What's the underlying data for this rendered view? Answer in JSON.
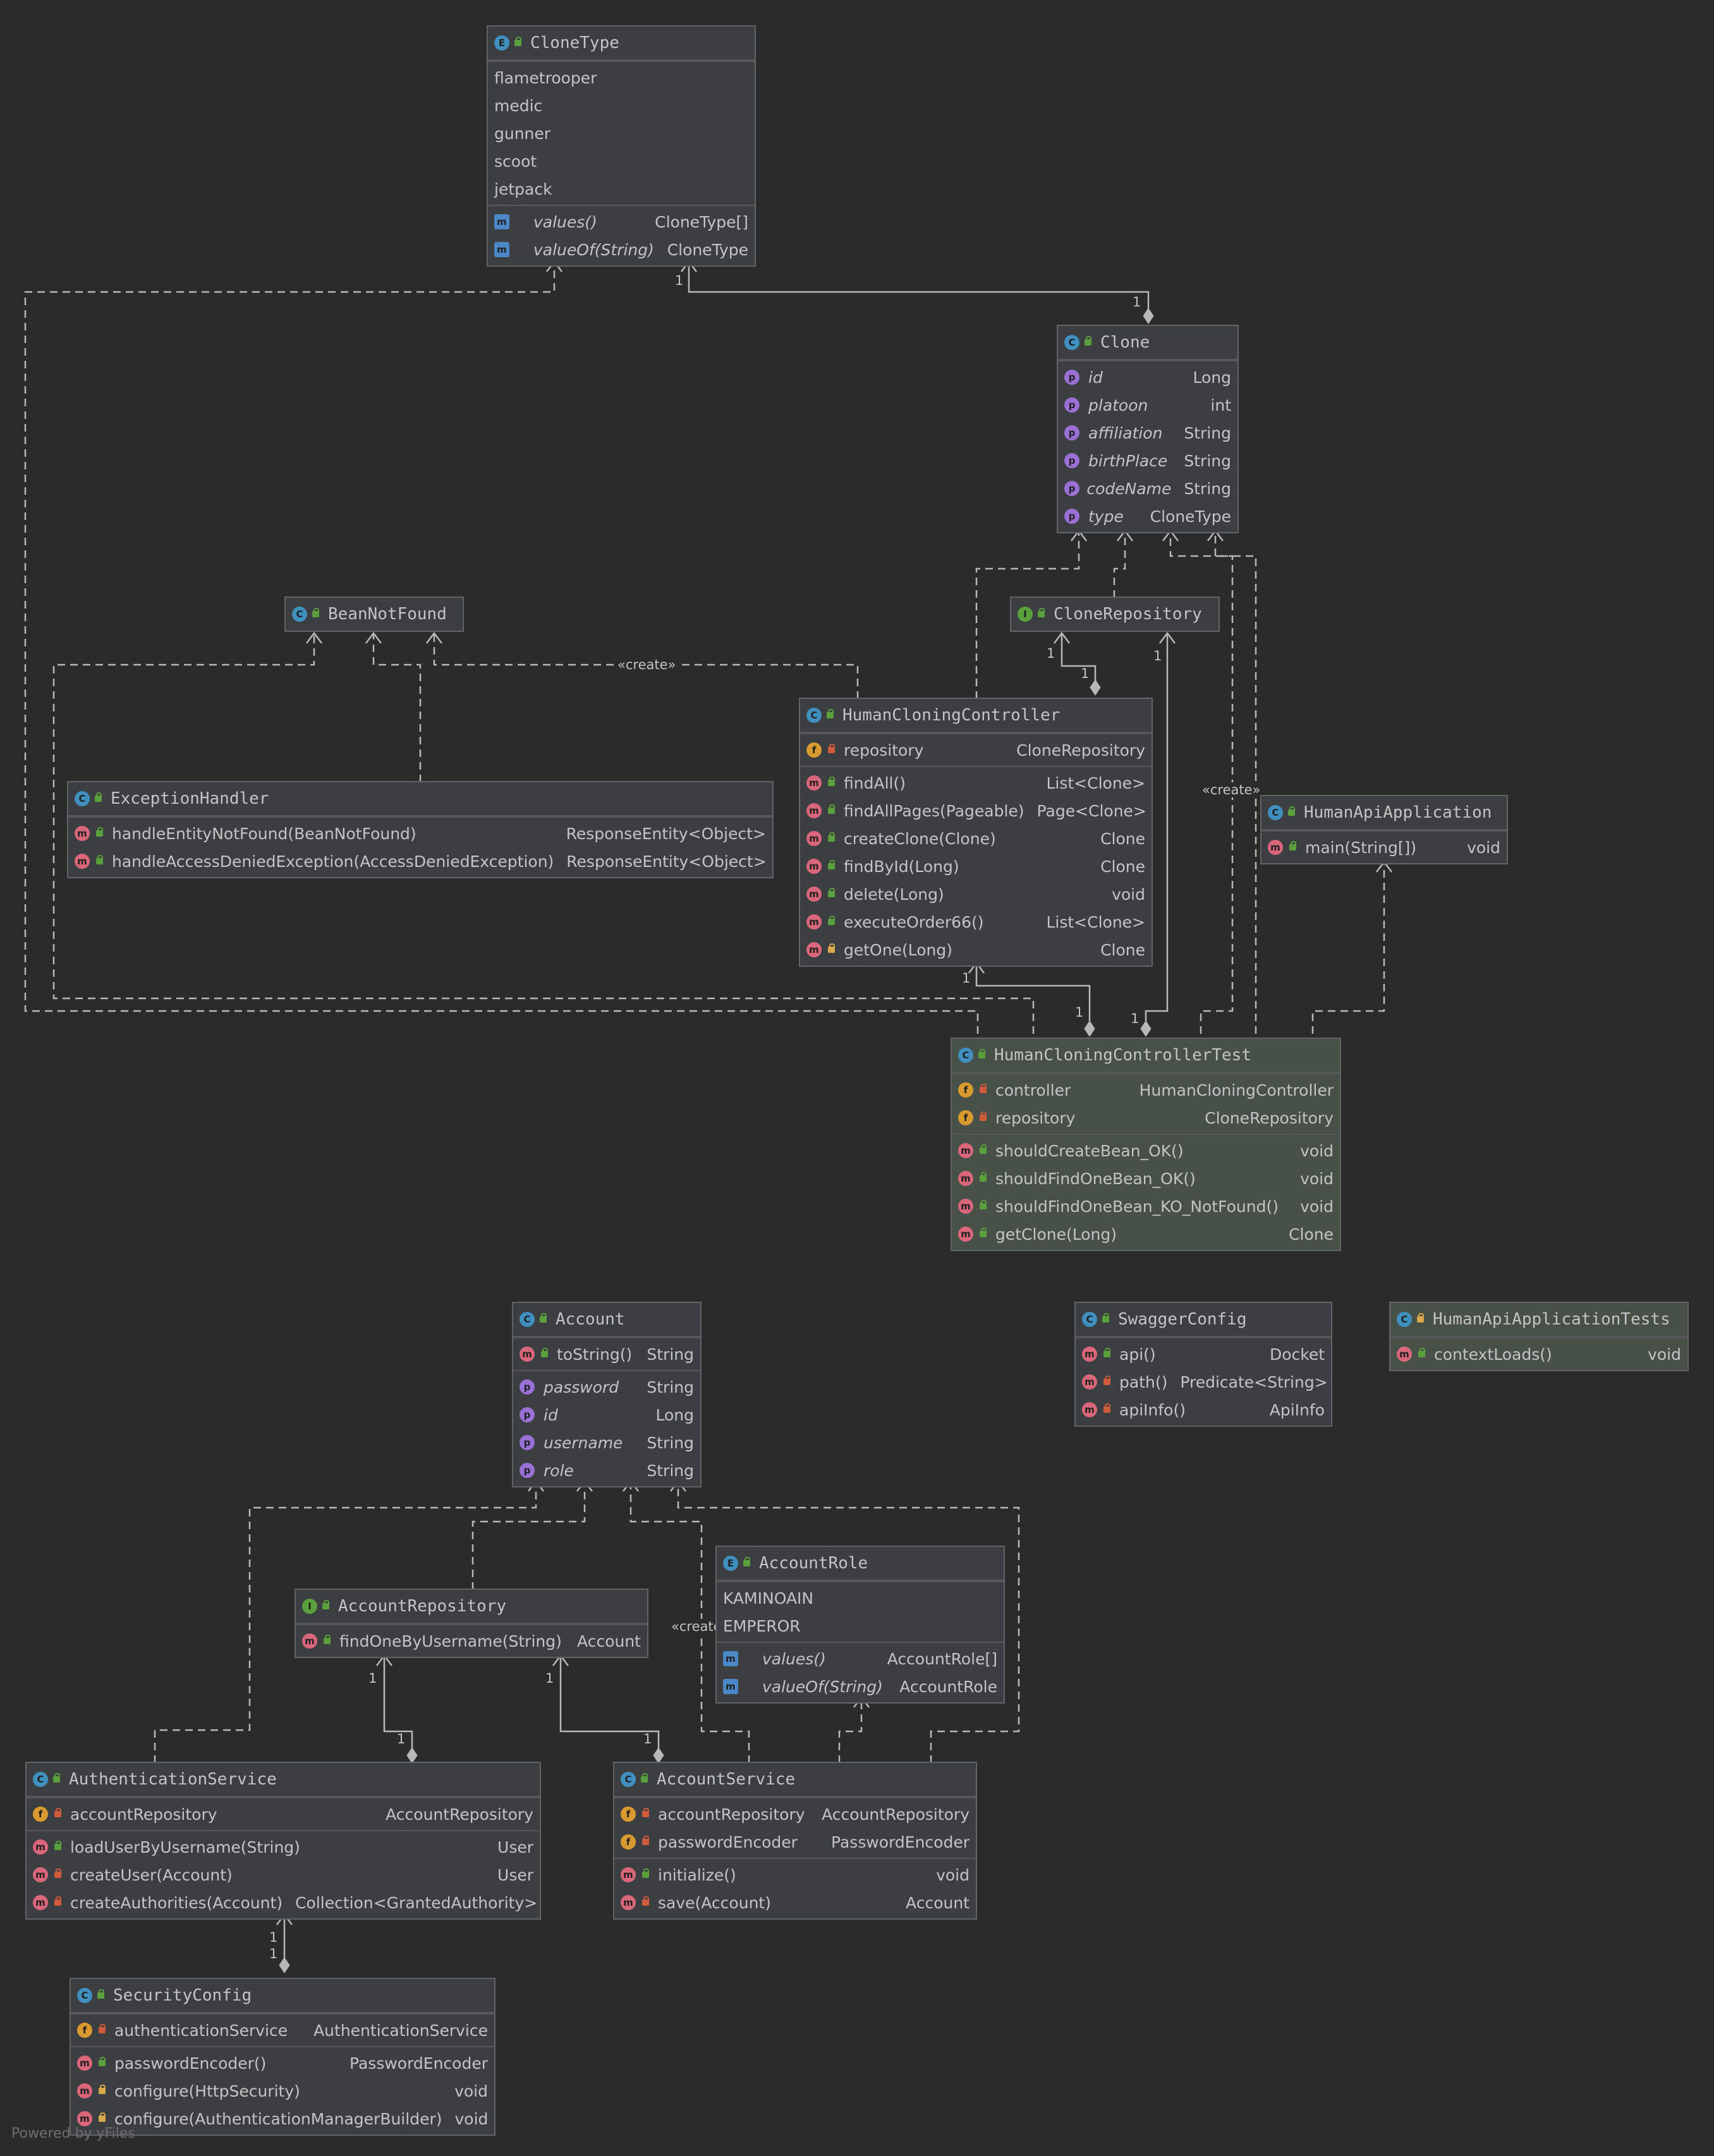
{
  "classes": {
    "CloneType": {
      "name": "CloneType",
      "kind": "enum",
      "constants": [
        "flametrooper",
        "medic",
        "gunner",
        "scoot",
        "jetpack"
      ],
      "methods": [
        {
          "name": "values()",
          "type": "CloneType[]"
        },
        {
          "name": "valueOf(String)",
          "type": "CloneType"
        }
      ]
    },
    "Clone": {
      "name": "Clone",
      "kind": "class",
      "properties": [
        {
          "name": "id",
          "type": "Long"
        },
        {
          "name": "platoon",
          "type": "int"
        },
        {
          "name": "affiliation",
          "type": "String"
        },
        {
          "name": "birthPlace",
          "type": "String"
        },
        {
          "name": "codeName",
          "type": "String"
        },
        {
          "name": "type",
          "type": "CloneType"
        }
      ]
    },
    "BeanNotFound": {
      "name": "BeanNotFound",
      "kind": "class"
    },
    "CloneRepository": {
      "name": "CloneRepository",
      "kind": "interface"
    },
    "HumanCloningController": {
      "name": "HumanCloningController",
      "kind": "class",
      "fields": [
        {
          "name": "repository",
          "type": "CloneRepository"
        }
      ],
      "methods": [
        {
          "name": "findAll()",
          "type": "List<Clone>"
        },
        {
          "name": "findAllPages(Pageable)",
          "type": "Page<Clone>"
        },
        {
          "name": "createClone(Clone)",
          "type": "Clone"
        },
        {
          "name": "findById(Long)",
          "type": "Clone"
        },
        {
          "name": "delete(Long)",
          "type": "void"
        },
        {
          "name": "executeOrder66()",
          "type": "List<Clone>"
        },
        {
          "name": "getOne(Long)",
          "type": "Clone"
        }
      ]
    },
    "ExceptionHandler": {
      "name": "ExceptionHandler",
      "kind": "class",
      "methods": [
        {
          "name": "handleEntityNotFound(BeanNotFound)",
          "type": "ResponseEntity<Object>"
        },
        {
          "name": "handleAccessDeniedException(AccessDeniedException)",
          "type": "ResponseEntity<Object>"
        }
      ]
    },
    "HumanApiApplication": {
      "name": "HumanApiApplication",
      "kind": "class",
      "methods": [
        {
          "name": "main(String[])",
          "type": "void"
        }
      ]
    },
    "HumanCloningControllerTest": {
      "name": "HumanCloningControllerTest",
      "kind": "test-class",
      "fields": [
        {
          "name": "controller",
          "type": "HumanCloningController"
        },
        {
          "name": "repository",
          "type": "CloneRepository"
        }
      ],
      "methods": [
        {
          "name": "shouldCreateBean_OK()",
          "type": "void"
        },
        {
          "name": "shouldFindOneBean_OK()",
          "type": "void"
        },
        {
          "name": "shouldFindOneBean_KO_NotFound()",
          "type": "void"
        },
        {
          "name": "getClone(Long)",
          "type": "Clone"
        }
      ]
    },
    "Account": {
      "name": "Account",
      "kind": "class",
      "methods": [
        {
          "name": "toString()",
          "type": "String"
        }
      ],
      "properties": [
        {
          "name": "password",
          "type": "String"
        },
        {
          "name": "id",
          "type": "Long"
        },
        {
          "name": "username",
          "type": "String"
        },
        {
          "name": "role",
          "type": "String"
        }
      ]
    },
    "SwaggerConfig": {
      "name": "SwaggerConfig",
      "kind": "class",
      "methods": [
        {
          "name": "api()",
          "type": "Docket"
        },
        {
          "name": "path()",
          "type": "Predicate<String>"
        },
        {
          "name": "apiInfo()",
          "type": "ApiInfo"
        }
      ]
    },
    "HumanApiApplicationTests": {
      "name": "HumanApiApplicationTests",
      "kind": "test-class",
      "methods": [
        {
          "name": "contextLoads()",
          "type": "void"
        }
      ]
    },
    "AccountRole": {
      "name": "AccountRole",
      "kind": "enum",
      "constants": [
        "KAMINOAIN",
        "EMPEROR"
      ],
      "methods": [
        {
          "name": "values()",
          "type": "AccountRole[]"
        },
        {
          "name": "valueOf(String)",
          "type": "AccountRole"
        }
      ]
    },
    "AccountRepository": {
      "name": "AccountRepository",
      "kind": "interface",
      "methods": [
        {
          "name": "findOneByUsername(String)",
          "type": "Account"
        }
      ]
    },
    "AuthenticationService": {
      "name": "AuthenticationService",
      "kind": "class",
      "fields": [
        {
          "name": "accountRepository",
          "type": "AccountRepository"
        }
      ],
      "methods": [
        {
          "name": "loadUserByUsername(String)",
          "type": "User"
        },
        {
          "name": "createUser(Account)",
          "type": "User"
        },
        {
          "name": "createAuthorities(Account)",
          "type": "Collection<GrantedAuthority>"
        }
      ]
    },
    "AccountService": {
      "name": "AccountService",
      "kind": "class",
      "fields": [
        {
          "name": "accountRepository",
          "type": "AccountRepository"
        },
        {
          "name": "passwordEncoder",
          "type": "PasswordEncoder"
        }
      ],
      "methods": [
        {
          "name": "initialize()",
          "type": "void"
        },
        {
          "name": "save(Account)",
          "type": "Account"
        }
      ]
    },
    "SecurityConfig": {
      "name": "SecurityConfig",
      "kind": "class",
      "fields": [
        {
          "name": "authenticationService",
          "type": "AuthenticationService"
        }
      ],
      "methods": [
        {
          "name": "passwordEncoder()",
          "type": "PasswordEncoder"
        },
        {
          "name": "configure(HttpSecurity)",
          "type": "void"
        },
        {
          "name": "configure(AuthenticationManagerBuilder)",
          "type": "void"
        }
      ]
    }
  },
  "edge_labels": {
    "create": "«create»",
    "create_truncated": "«create",
    "one": "1"
  },
  "footer": "Powered by yFiles",
  "colors": {
    "background": "#2b2b2b",
    "box": "#3c3f41",
    "test_box": "#485147",
    "edge": "#b8b8b8"
  }
}
